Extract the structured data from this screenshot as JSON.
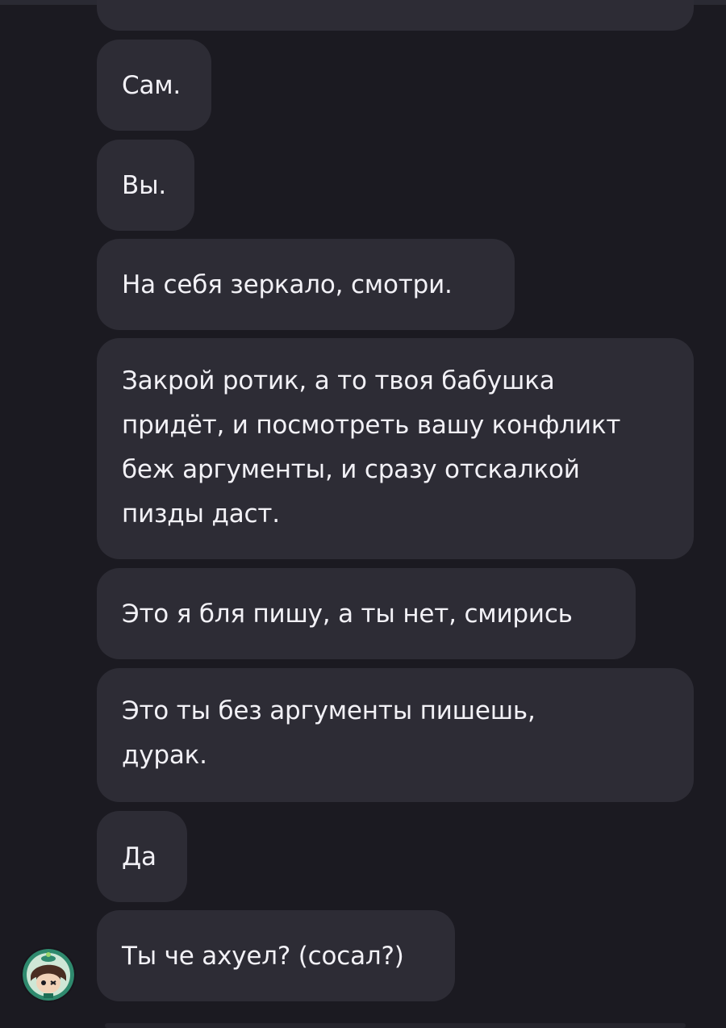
{
  "chat": {
    "messages": [
      {
        "text": "Сам."
      },
      {
        "text": "Вы."
      },
      {
        "text": "На себя зеркало, смотри."
      },
      {
        "text": "Закрой ротик, а то твоя бабушка придёт, и посмотреть вашу конфликт беж аргументы, и сразу отскалкой пизды даст."
      },
      {
        "text": "Это я бля пишу, а ты нет, смирись"
      },
      {
        "text": "Это ты без аргументы пишешь, дурак."
      },
      {
        "text": "Да"
      },
      {
        "text": "Ты че ахуел? (сосал?)"
      }
    ],
    "sender_avatar_icon": "avatar-icon"
  },
  "colors": {
    "background": "#1b1a21",
    "bubble": "#2d2c35",
    "text": "#f2f1f6",
    "avatar_ring": "#2f8a6e"
  }
}
